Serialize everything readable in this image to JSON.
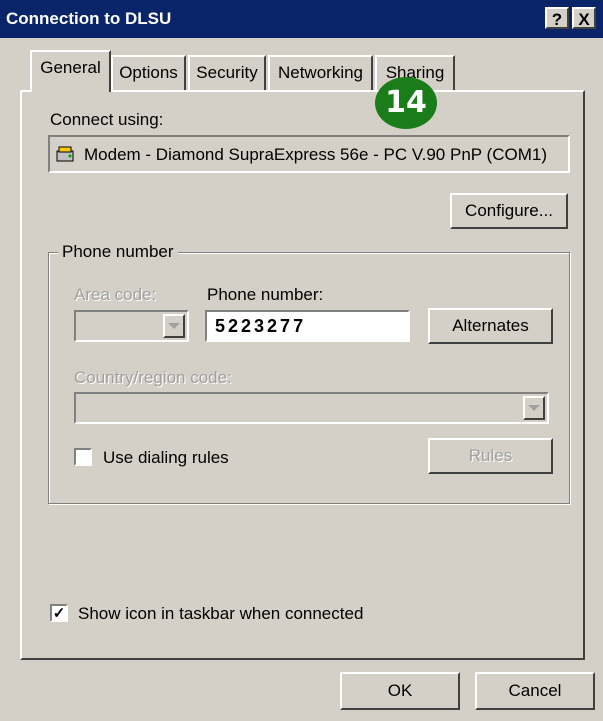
{
  "window": {
    "title": "Connection to DLSU",
    "help_button": "?",
    "close_button": "X"
  },
  "tabs": [
    {
      "label": "General",
      "active": true
    },
    {
      "label": "Options"
    },
    {
      "label": "Security"
    },
    {
      "label": "Networking"
    },
    {
      "label": "Sharing"
    }
  ],
  "badge": "14",
  "connect_using": {
    "label": "Connect using:",
    "device": "Modem - Diamond SupraExpress 56e - PC V.90 PnP (COM1)",
    "device_icon": "modem-icon",
    "configure_button": "Configure..."
  },
  "phone": {
    "group_label": "Phone number",
    "area_code_label": "Area code:",
    "phone_number_label": "Phone number:",
    "phone_number_value": "5223277",
    "alternates_button": "Alternates",
    "country_label": "Country/region code:",
    "use_dialing_rules_label": "Use dialing rules",
    "use_dialing_rules_checked": false,
    "rules_button": "Rules"
  },
  "show_icon": {
    "label": "Show icon in taskbar when connected",
    "checked": true
  },
  "footer": {
    "ok_button": "OK",
    "cancel_button": "Cancel"
  }
}
